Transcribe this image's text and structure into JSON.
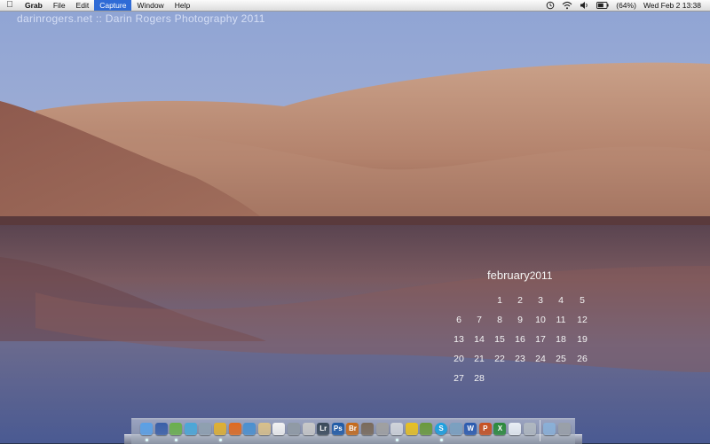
{
  "menubar": {
    "apple_icon": "apple-icon",
    "app_name": "Grab",
    "items": [
      "File",
      "Edit",
      "Capture",
      "Window",
      "Help"
    ],
    "active_item": "Capture",
    "status": {
      "icons": [
        "time-machine-icon",
        "wifi-icon",
        "volume-icon",
        "battery-icon"
      ],
      "battery_text": "(64%)",
      "clock": "Wed Feb 2  13:38"
    }
  },
  "desktop": {
    "watermark": "darinrogers.net :: Darin Rogers Photography 2011"
  },
  "calendar": {
    "month": "february",
    "year": "2011",
    "weeks": [
      [
        "",
        "",
        "1",
        "2",
        "3",
        "4",
        "5"
      ],
      [
        "6",
        "7",
        "8",
        "9",
        "10",
        "11",
        "12"
      ],
      [
        "13",
        "14",
        "15",
        "16",
        "17",
        "18",
        "19"
      ],
      [
        "20",
        "21",
        "22",
        "23",
        "24",
        "25",
        "26"
      ],
      [
        "27",
        "28",
        "",
        "",
        "",
        "",
        ""
      ]
    ]
  },
  "dock": {
    "apps": [
      {
        "name": "finder",
        "icon": "finder-icon",
        "color": "#5aa0e6",
        "running": true
      },
      {
        "name": "dashboard",
        "icon": "dashboard-icon",
        "color": "#3a5fa8",
        "running": false
      },
      {
        "name": "mail",
        "icon": "mail-icon",
        "color": "#6ab04c",
        "running": true
      },
      {
        "name": "itunes",
        "icon": "itunes-icon",
        "color": "#4aa7d8",
        "running": false
      },
      {
        "name": "preview",
        "icon": "preview-icon",
        "color": "#8fa0b0",
        "running": false
      },
      {
        "name": "chrome",
        "icon": "chrome-icon",
        "color": "#e0b030",
        "running": true
      },
      {
        "name": "firefox",
        "icon": "firefox-icon",
        "color": "#e06a20",
        "running": false
      },
      {
        "name": "safari",
        "icon": "safari-icon",
        "color": "#4a90d0",
        "running": false
      },
      {
        "name": "notes",
        "icon": "notes-icon",
        "color": "#d9c08a",
        "running": false
      },
      {
        "name": "ical",
        "icon": "calendar-icon",
        "color": "#f2f2f2",
        "running": false
      },
      {
        "name": "system-preferences",
        "icon": "gear-icon",
        "color": "#909aa4",
        "running": false
      },
      {
        "name": "textedit",
        "icon": "textedit-icon",
        "color": "#c8c8c8",
        "running": false
      },
      {
        "name": "lightroom",
        "icon": "lightroom-icon",
        "color": "#3a4a5a",
        "label": "Lr",
        "running": false
      },
      {
        "name": "photoshop",
        "icon": "photoshop-icon",
        "color": "#1f5aa6",
        "label": "Ps",
        "running": false
      },
      {
        "name": "bridge",
        "icon": "bridge-icon",
        "color": "#c66a1a",
        "label": "Br",
        "running": false
      },
      {
        "name": "photo-app",
        "icon": "photo-icon",
        "color": "#7a6a5a",
        "running": false
      },
      {
        "name": "utility",
        "icon": "tools-icon",
        "color": "#a0a0a0",
        "running": false
      },
      {
        "name": "grab",
        "icon": "grab-icon",
        "color": "#d0d4da",
        "running": true
      },
      {
        "name": "cyberduck",
        "icon": "duck-icon",
        "color": "#e8c020",
        "running": false
      },
      {
        "name": "colorsync",
        "icon": "colorsync-icon",
        "color": "#6a9a3a",
        "running": false
      },
      {
        "name": "skype",
        "icon": "skype-icon",
        "color": "#1aa0e0",
        "label": "S",
        "round": true,
        "running": true
      },
      {
        "name": "network",
        "icon": "globe-icon",
        "color": "#7aa0c0",
        "running": false
      },
      {
        "name": "word",
        "icon": "word-icon",
        "color": "#2a5ab0",
        "label": "W",
        "running": false
      },
      {
        "name": "powerpoint",
        "icon": "powerpoint-icon",
        "color": "#c85020",
        "label": "P",
        "running": false
      },
      {
        "name": "excel",
        "icon": "excel-icon",
        "color": "#2a8a3a",
        "label": "X",
        "running": false
      },
      {
        "name": "document",
        "icon": "document-icon",
        "color": "#e8eef4",
        "running": false
      },
      {
        "name": "archive",
        "icon": "archive-icon",
        "color": "#b0b8c0",
        "running": false
      },
      {
        "name": "downloads",
        "icon": "downloads-folder-icon",
        "color": "#8ab0d8",
        "running": false
      },
      {
        "name": "trash",
        "icon": "trash-icon",
        "color": "#9aa0a8",
        "running": false
      }
    ]
  }
}
